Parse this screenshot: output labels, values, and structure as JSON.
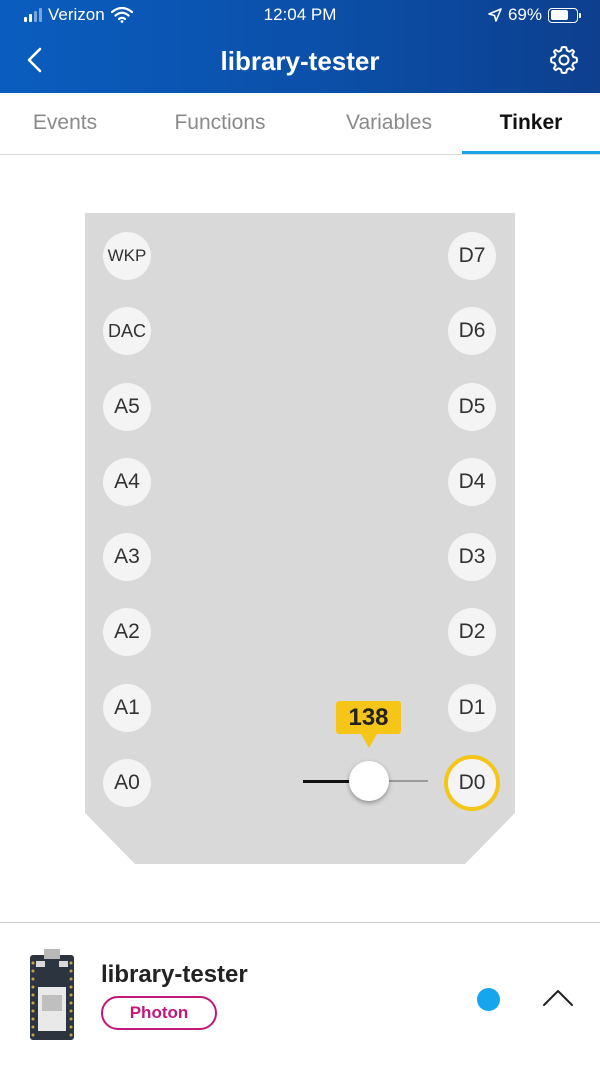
{
  "status_bar": {
    "carrier": "Verizon",
    "time": "12:04 PM",
    "battery": "69%",
    "battery_level": 0.69
  },
  "header": {
    "title": "library-tester"
  },
  "tabs": [
    {
      "label": "Events",
      "active": false
    },
    {
      "label": "Functions",
      "active": false
    },
    {
      "label": "Variables",
      "active": false
    },
    {
      "label": "Tinker",
      "active": true
    }
  ],
  "board": {
    "left_pins": [
      "WKP",
      "DAC",
      "A5",
      "A4",
      "A3",
      "A2",
      "A1",
      "A0"
    ],
    "right_pins": [
      "D7",
      "D6",
      "D5",
      "D4",
      "D3",
      "D2",
      "D1",
      "D0"
    ],
    "selected_pin": "D0",
    "slider": {
      "value": "138",
      "min": 0,
      "max": 255
    }
  },
  "footer": {
    "device_name": "library-tester",
    "device_type": "Photon",
    "online_color": "#16a6ee"
  },
  "colors": {
    "header_blue": "#0b4fa8",
    "accent_yellow": "#f5c518",
    "tab_underline": "#1aa3e6",
    "photon_magenta": "#c2187a"
  }
}
